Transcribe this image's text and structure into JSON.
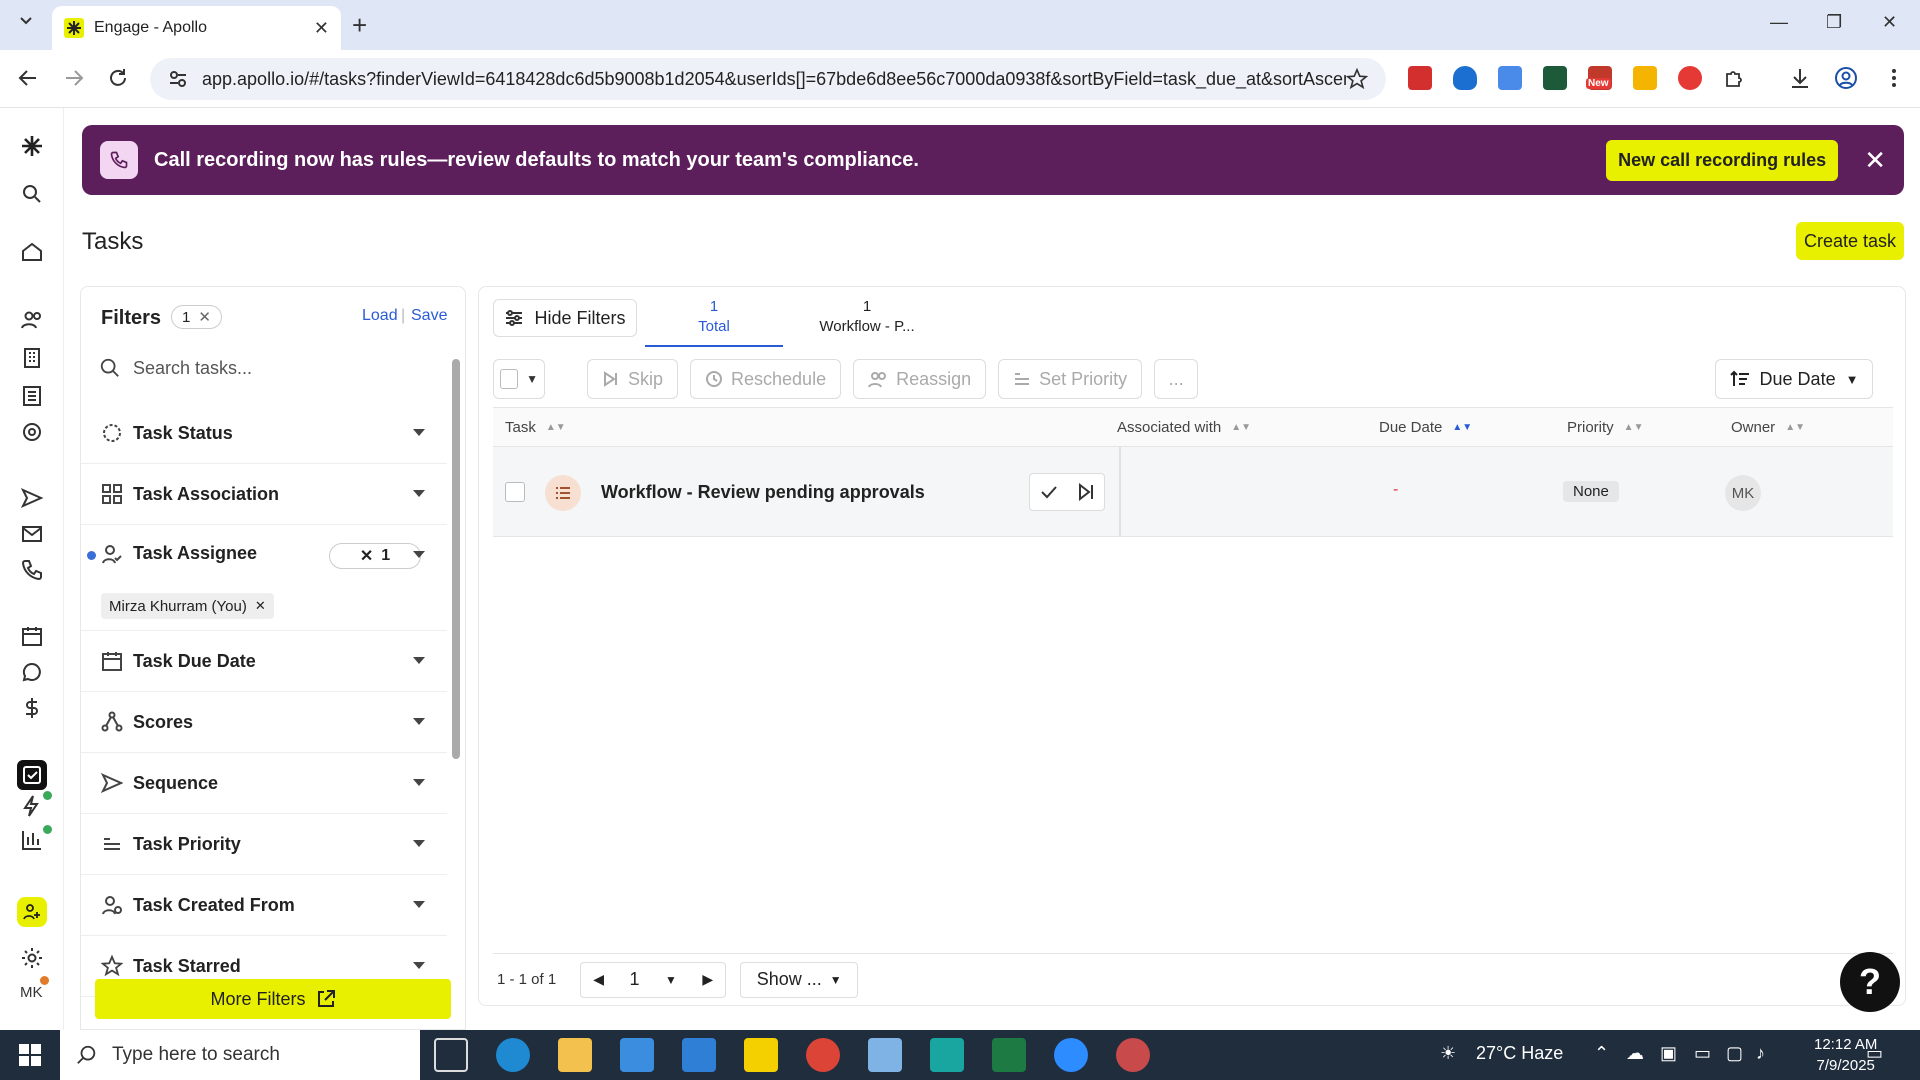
{
  "browser": {
    "tab_title": "Engage - Apollo",
    "url": "app.apollo.io/#/tasks?finderViewId=6418428dc6d5b9008b1d2054&userIds[]=67bde6d8ee56c7000da0938f&sortByField=task_due_at&sortAscen...",
    "ext_badge": "New"
  },
  "banner": {
    "text": "Call recording now has rules—review defaults to match your team's compliance.",
    "button": "New call recording rules"
  },
  "page": {
    "title": "Tasks",
    "create_button": "Create task"
  },
  "filters": {
    "title": "Filters",
    "count": "1",
    "load": "Load",
    "save": "Save",
    "search_placeholder": "Search tasks...",
    "items": [
      {
        "label": "Task Status",
        "icon": "status-icon"
      },
      {
        "label": "Task Association",
        "icon": "grid-icon"
      },
      {
        "label": "Task Assignee",
        "icon": "assignee-icon",
        "badge": "1"
      },
      {
        "label": "Task Due Date",
        "icon": "calendar-icon"
      },
      {
        "label": "Scores",
        "icon": "scores-icon"
      },
      {
        "label": "Sequence",
        "icon": "send-icon"
      },
      {
        "label": "Task Priority",
        "icon": "priority-icon"
      },
      {
        "label": "Task Created From",
        "icon": "user-icon"
      },
      {
        "label": "Task Starred",
        "icon": "star-icon"
      }
    ],
    "assignee_chip": "Mirza Khurram (You)",
    "more_filters": "More Filters"
  },
  "main": {
    "hide_filters": "Hide Filters",
    "tabs": [
      {
        "count": "1",
        "label": "Total"
      },
      {
        "count": "1",
        "label": "Workflow - P..."
      }
    ],
    "toolbar": {
      "skip": "Skip",
      "reschedule": "Reschedule",
      "reassign": "Reassign",
      "set_priority": "Set Priority",
      "more": "...",
      "sort": "Due Date"
    },
    "columns": [
      "Task",
      "Associated with",
      "Due Date",
      "Priority",
      "Owner"
    ],
    "rows": [
      {
        "task": "Workflow - Review pending approvals",
        "associated": "",
        "due": "-",
        "priority": "None",
        "owner": "MK"
      }
    ],
    "footer": {
      "range": "1 - 1 of 1",
      "page": "1",
      "show": "Show ..."
    }
  },
  "rail": {
    "user_initials": "MK"
  },
  "taskbar": {
    "search_placeholder": "Type here to search",
    "weather": "27°C  Haze",
    "time": "12:12 AM",
    "date": "7/9/2025"
  },
  "colors": {
    "banner_bg": "#5c1f5c",
    "accent_yellow": "#e8f000",
    "link_blue": "#2a5bd7"
  }
}
